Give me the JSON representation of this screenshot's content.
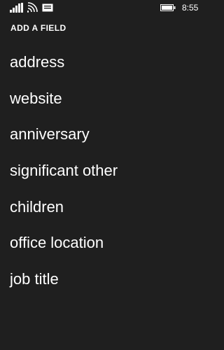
{
  "status_bar": {
    "time": "8:55",
    "icons": [
      "signal-icon",
      "wifi-icon",
      "message-icon",
      "battery-icon"
    ]
  },
  "header": {
    "title": "ADD A FIELD"
  },
  "fields": [
    {
      "label": "address"
    },
    {
      "label": "website"
    },
    {
      "label": "anniversary"
    },
    {
      "label": "significant other"
    },
    {
      "label": "children"
    },
    {
      "label": "office location"
    },
    {
      "label": "job title"
    }
  ],
  "colors": {
    "background": "#1f1f1f",
    "text": "#ffffff"
  }
}
